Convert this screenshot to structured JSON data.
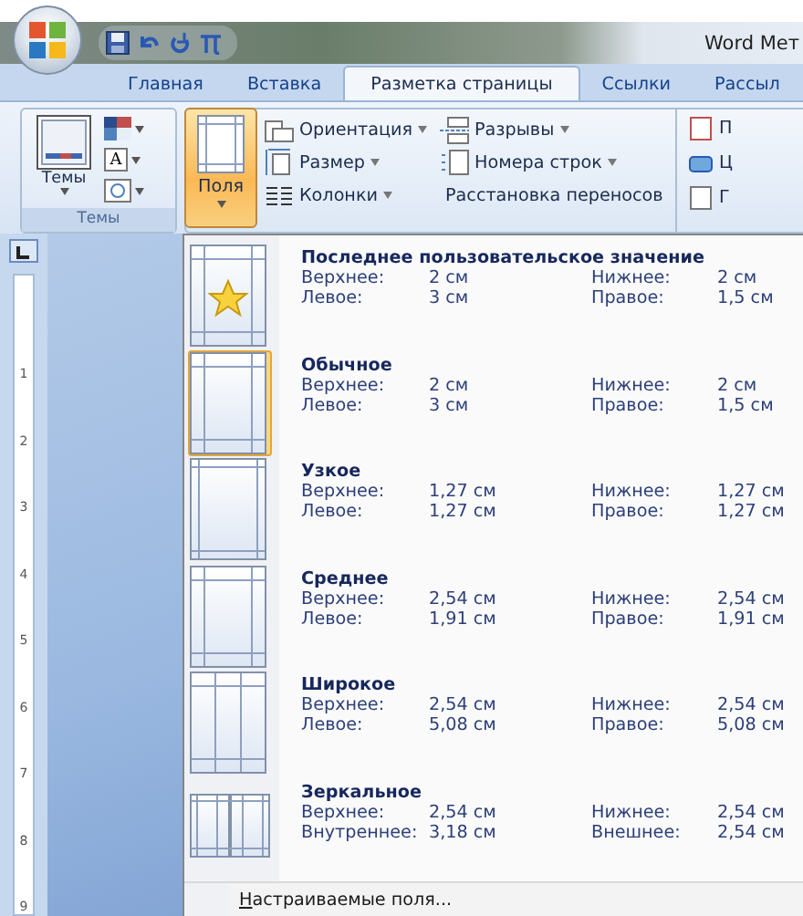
{
  "window": {
    "title": "Word Мет"
  },
  "tabs": [
    {
      "label": "Главная",
      "selected": false
    },
    {
      "label": "Вставка",
      "selected": false
    },
    {
      "label": "Разметка страницы",
      "selected": true
    },
    {
      "label": "Ссылки",
      "selected": false
    },
    {
      "label": "Рассыл",
      "selected": false
    }
  ],
  "ribbon": {
    "themes_button": "Темы",
    "themes_group": "Темы",
    "font_button": "A",
    "margins_button": {
      "label": "Поля",
      "expanded": true
    },
    "commands": [
      {
        "kind": "orientation",
        "label": "Ориентация"
      },
      {
        "kind": "size",
        "label": "Размер"
      },
      {
        "kind": "columns",
        "label": "Колонки"
      },
      {
        "kind": "breaks",
        "label": "Разрывы"
      },
      {
        "kind": "linenumbers",
        "label": "Номера строк"
      },
      {
        "kind": "hyphenation",
        "label": "Расстановка переносов"
      }
    ],
    "cut_commands": [
      "П",
      "Ц",
      "Г"
    ]
  },
  "ruler": {
    "marks": [
      "1",
      "2",
      "3",
      "4",
      "5",
      "6",
      "7",
      "8",
      "9"
    ]
  },
  "margins_menu": {
    "items": [
      {
        "kind": "custom",
        "name": "Последнее пользовательское значение",
        "selected": false,
        "fields": [
          {
            "label": "Верхнее:",
            "value": "2 см"
          },
          {
            "label": "Нижнее:",
            "value": "2 см"
          },
          {
            "label": "Левое:",
            "value": "3 см"
          },
          {
            "label": "Правое:",
            "value": "1,5 см"
          }
        ]
      },
      {
        "kind": "normal",
        "name": "Обычное",
        "selected": true,
        "fields": [
          {
            "label": "Верхнее:",
            "value": "2 см"
          },
          {
            "label": "Нижнее:",
            "value": "2 см"
          },
          {
            "label": "Левое:",
            "value": "3 см"
          },
          {
            "label": "Правое:",
            "value": "1,5 см"
          }
        ]
      },
      {
        "kind": "narrow",
        "name": "Узкое",
        "selected": false,
        "fields": [
          {
            "label": "Верхнее:",
            "value": "1,27 см"
          },
          {
            "label": "Нижнее:",
            "value": "1,27 см"
          },
          {
            "label": "Левое:",
            "value": "1,27 см"
          },
          {
            "label": "Правое:",
            "value": "1,27 см"
          }
        ]
      },
      {
        "kind": "medium",
        "name": "Среднее",
        "selected": false,
        "fields": [
          {
            "label": "Верхнее:",
            "value": "2,54 см"
          },
          {
            "label": "Нижнее:",
            "value": "2,54 см"
          },
          {
            "label": "Левое:",
            "value": "1,91 см"
          },
          {
            "label": "Правое:",
            "value": "1,91 см"
          }
        ]
      },
      {
        "kind": "wide",
        "name": "Широкое",
        "selected": false,
        "fields": [
          {
            "label": "Верхнее:",
            "value": "2,54 см"
          },
          {
            "label": "Нижнее:",
            "value": "2,54 см"
          },
          {
            "label": "Левое:",
            "value": "5,08 см"
          },
          {
            "label": "Правое:",
            "value": "5,08 см"
          }
        ]
      },
      {
        "kind": "mirrored",
        "name": "Зеркальное",
        "selected": false,
        "fields": [
          {
            "label": "Верхнее:",
            "value": "2,54 см"
          },
          {
            "label": "Нижнее:",
            "value": "2,54 см"
          },
          {
            "label": "Внутреннее:",
            "value": "3,18 см"
          },
          {
            "label": "Внешнее:",
            "value": "2,54 см"
          }
        ]
      }
    ],
    "footer": "Настраиваемые поля..."
  }
}
